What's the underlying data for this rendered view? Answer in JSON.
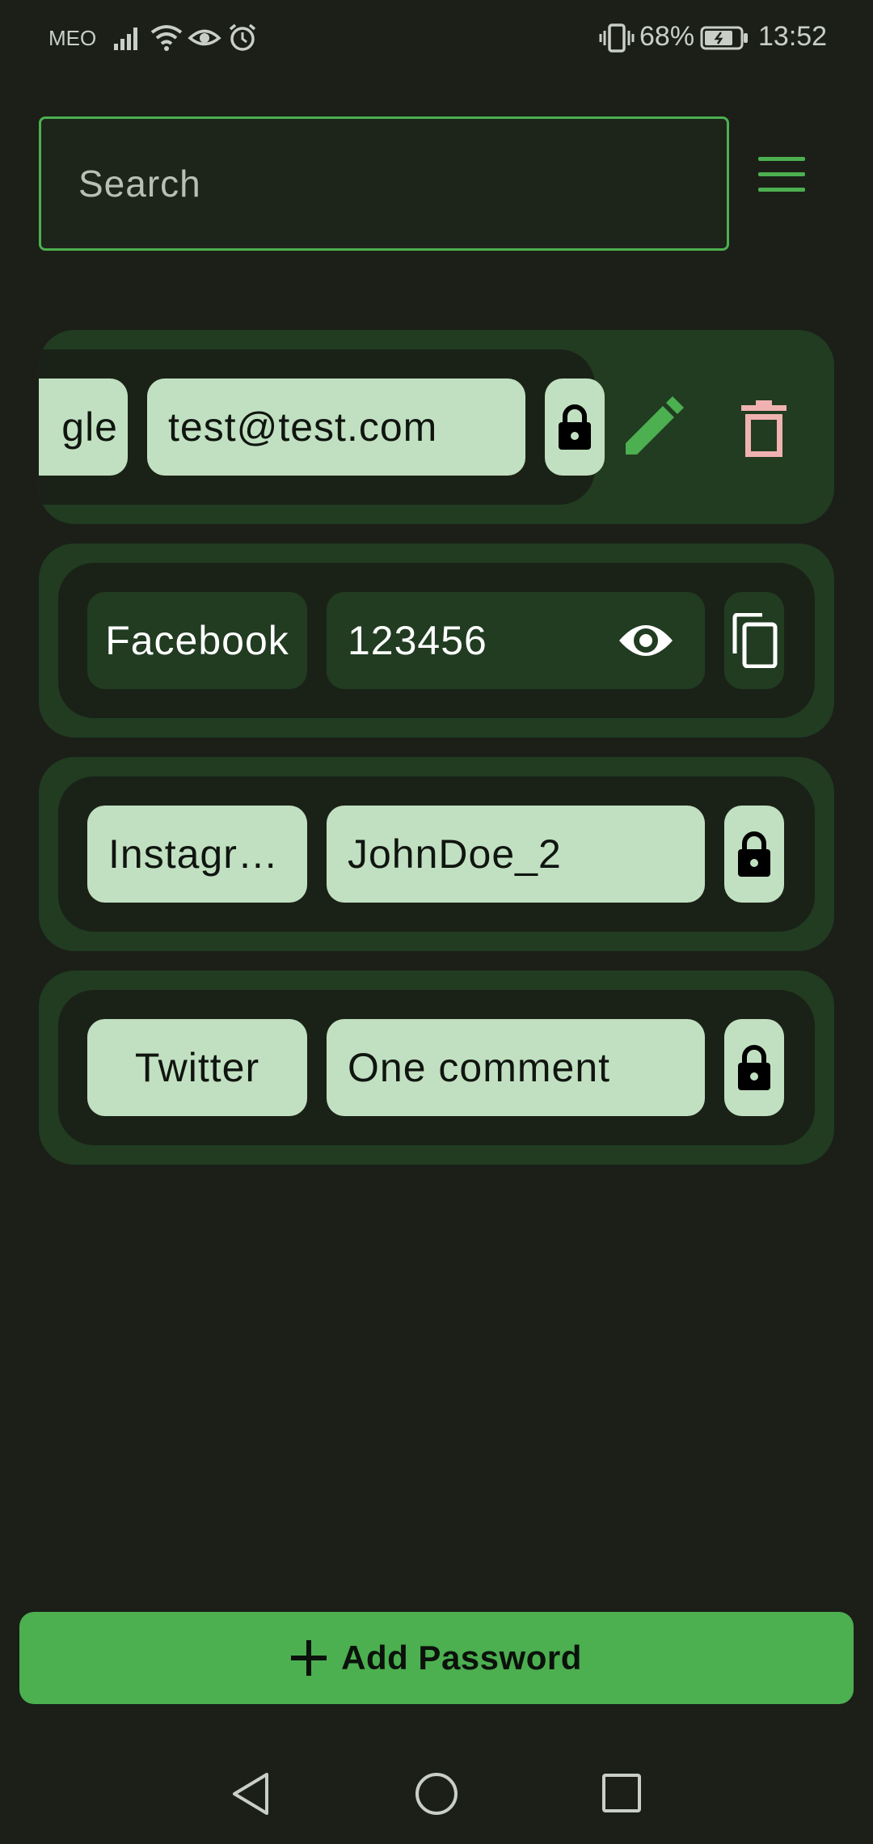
{
  "status_bar": {
    "carrier": "MEO",
    "battery": "68%",
    "time": "13:52"
  },
  "search": {
    "placeholder": "Search",
    "value": ""
  },
  "entries": [
    {
      "name": "Google",
      "name_visible": "gle",
      "secret": "test@test.com",
      "state": "hidden",
      "swiped": true,
      "actions": [
        "edit",
        "delete"
      ]
    },
    {
      "name": "Facebook",
      "secret": "123456",
      "state": "revealed"
    },
    {
      "name": "Instagr…",
      "secret": "JohnDoe_2",
      "state": "hidden"
    },
    {
      "name": "Twitter",
      "secret": "One comment",
      "state": "hidden"
    }
  ],
  "add_button": {
    "label": "Add Password"
  },
  "colors": {
    "background": "#1b1f18",
    "accent": "#4caf50",
    "card": "#213c21",
    "chip": "#c1e0c1",
    "delete": "#f0b2b0"
  },
  "icons": [
    "signal-icon",
    "wifi-icon",
    "eye-comfort-icon",
    "alarm-icon",
    "vibrate-icon",
    "battery-icon",
    "menu-icon",
    "lock-icon",
    "edit-icon",
    "delete-icon",
    "visibility-icon",
    "copy-icon",
    "add-icon",
    "back-icon",
    "home-icon",
    "recents-icon"
  ]
}
